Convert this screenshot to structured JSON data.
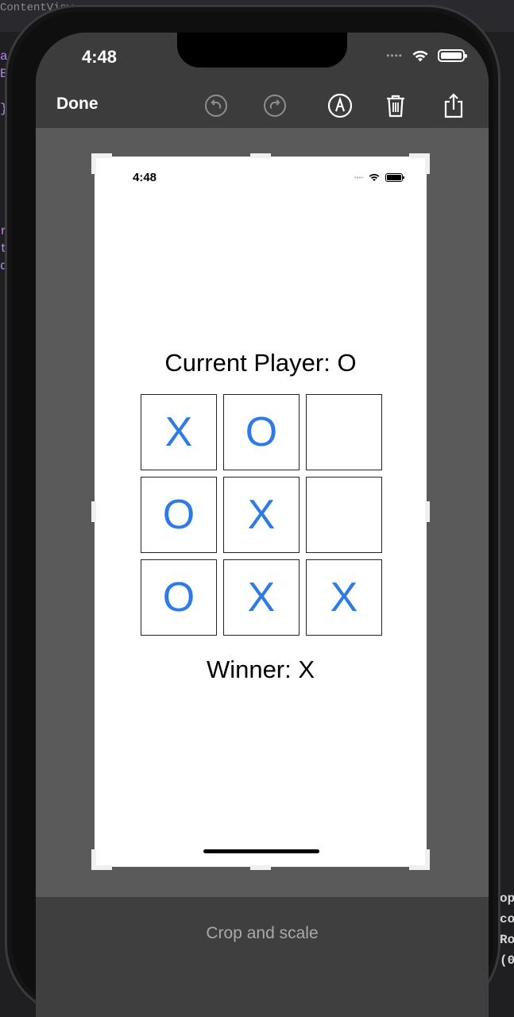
{
  "background": {
    "ide_top_text": "ContentView",
    "ide_left_lines": [
      "a",
      "B",
      "",
      "}",
      "",
      "",
      "",
      "",
      "",
      "",
      "r",
      "t",
      "d"
    ],
    "ide_right_lines": [
      "op",
      "co",
      "Ro",
      "(0"
    ]
  },
  "status_bar": {
    "time": "4:48",
    "signal_icon": "cellular-dots-icon",
    "wifi_icon": "wifi-icon",
    "battery_icon": "battery-icon"
  },
  "toolbar": {
    "done_label": "Done",
    "undo_icon": "undo-icon",
    "redo_icon": "redo-icon",
    "markup_icon": "markup-pen-icon",
    "delete_icon": "trash-icon",
    "share_icon": "share-icon"
  },
  "screenshot": {
    "status_time": "4:48",
    "current_player": "Current Player: O",
    "board": [
      [
        "X",
        "O",
        ""
      ],
      [
        "O",
        "X",
        ""
      ],
      [
        "O",
        "X",
        "X"
      ]
    ],
    "winner": "Winner: X"
  },
  "bottom": {
    "crop_label": "Crop and scale"
  },
  "colors": {
    "mark_color": "#2f7be6",
    "canvas_bg": "#5a5a5a",
    "toolbar_bg": "#3c3c3c"
  }
}
